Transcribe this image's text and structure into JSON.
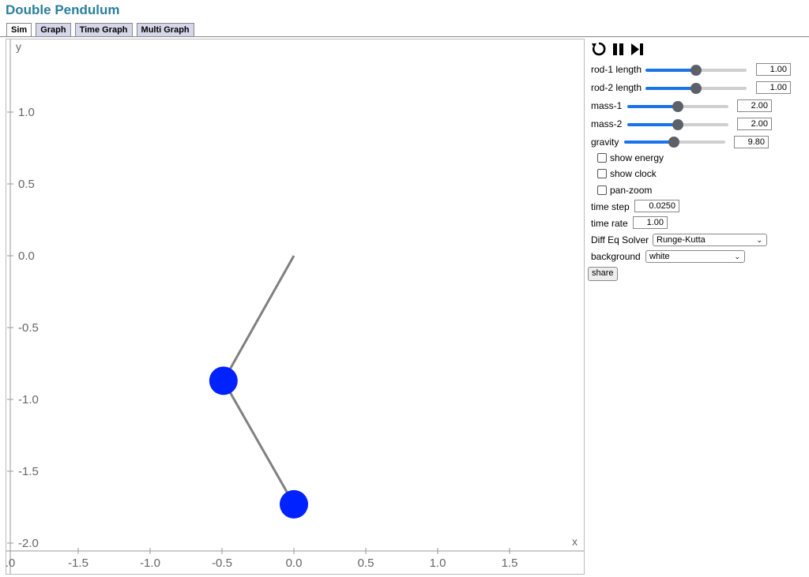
{
  "app": {
    "title": "Double Pendulum"
  },
  "tabs": [
    {
      "label": "Sim",
      "active": true
    },
    {
      "label": "Graph",
      "active": false
    },
    {
      "label": "Time Graph",
      "active": false
    },
    {
      "label": "Multi Graph",
      "active": false
    }
  ],
  "plot": {
    "xlabel": "x",
    "ylabel": "y",
    "xticks": [
      ".0",
      "-1.5",
      "-1.0",
      "-0.5",
      "0.0",
      "0.5",
      "1.0",
      "1.5"
    ],
    "yticks": [
      "1.0",
      "0.5",
      "0.0",
      "-0.5",
      "-1.0",
      "-1.5",
      "-2.0"
    ],
    "pivot": {
      "x": 0.0,
      "y": 0.0
    },
    "bob1": {
      "x": -0.49,
      "y": -0.87
    },
    "bob2": {
      "x": 0.0,
      "y": -1.73
    },
    "rod_color": "#808080",
    "bob_color": "#0022ff"
  },
  "controls": {
    "icons": [
      "restart-icon",
      "pause-icon",
      "step-icon"
    ],
    "sliders": [
      {
        "label": "rod-1 length",
        "value": "1.00",
        "fraction": 0.5
      },
      {
        "label": "rod-2 length",
        "value": "1.00",
        "fraction": 0.5
      },
      {
        "label": "mass-1",
        "value": "2.00",
        "fraction": 0.5
      },
      {
        "label": "mass-2",
        "value": "2.00",
        "fraction": 0.5
      },
      {
        "label": "gravity",
        "value": "9.80",
        "fraction": 0.49
      }
    ],
    "checkboxes": [
      {
        "label": "show energy",
        "checked": false
      },
      {
        "label": "show clock",
        "checked": false
      },
      {
        "label": "pan-zoom",
        "checked": false
      }
    ],
    "time_step": {
      "label": "time step",
      "value": "0.0250"
    },
    "time_rate": {
      "label": "time rate",
      "value": "1.00"
    },
    "solver": {
      "label": "Diff Eq Solver",
      "value": "Runge-Kutta"
    },
    "background": {
      "label": "background",
      "value": "white"
    },
    "share_label": "share",
    "accent": "#1a73e8"
  }
}
